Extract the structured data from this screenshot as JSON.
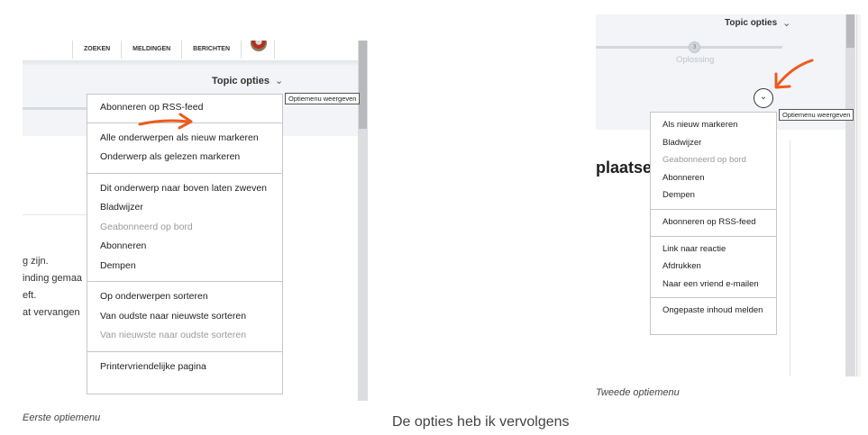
{
  "left_shot": {
    "navbar": [
      "ZOEKEN",
      "MELDINGEN",
      "BERICHTEN"
    ],
    "topic_options_label": "Topic opties",
    "tooltip": "Optiemenu weergeven",
    "menu_sections": [
      [
        {
          "label": "Abonneren op RSS-feed",
          "disabled": false
        }
      ],
      [
        {
          "label": "Alle onderwerpen als nieuw markeren",
          "disabled": false
        },
        {
          "label": "Onderwerp als gelezen markeren",
          "disabled": false
        }
      ],
      [
        {
          "label": "Dit onderwerp naar boven laten zweven",
          "disabled": false
        },
        {
          "label": "Bladwijzer",
          "disabled": false
        },
        {
          "label": "Geabonneerd op bord",
          "disabled": true
        },
        {
          "label": "Abonneren",
          "disabled": false
        },
        {
          "label": "Dempen",
          "disabled": false
        }
      ],
      [
        {
          "label": "Op onderwerpen sorteren",
          "disabled": false
        },
        {
          "label": "Van oudste naar nieuwste sorteren",
          "disabled": false
        },
        {
          "label": "Van nieuwste naar oudste sorteren",
          "disabled": true
        }
      ],
      [
        {
          "label": "Printervriendelijke pagina",
          "disabled": false
        }
      ]
    ],
    "background_lines": [
      "g zijn.",
      "inding gemaa",
      "eft.",
      "at vervangen"
    ],
    "caption": "Eerste optiemenu"
  },
  "right_shot": {
    "topic_options_label": "Topic opties",
    "step_number": "3",
    "step_label": "Oplossing",
    "tooltip": "Optiemenu weergeven",
    "heading_fragment": "plaatsen",
    "menu_sections": [
      [
        {
          "label": "Als nieuw markeren",
          "disabled": false
        },
        {
          "label": "Bladwijzer",
          "disabled": false
        },
        {
          "label": "Geabonneerd op bord",
          "disabled": true
        },
        {
          "label": "Abonneren",
          "disabled": false
        },
        {
          "label": "Dempen",
          "disabled": false
        }
      ],
      [
        {
          "label": "Abonneren op RSS-feed",
          "disabled": false
        }
      ],
      [
        {
          "label": "Link naar reactie",
          "disabled": false
        },
        {
          "label": "Afdrukken",
          "disabled": false
        },
        {
          "label": "Naar een vriend e-mailen",
          "disabled": false
        }
      ],
      [
        {
          "label": "Ongepaste inhoud melden",
          "disabled": false
        }
      ]
    ],
    "caption": "Tweede optiemenu"
  },
  "body_text": "De opties heb ik vervolgens",
  "colors": {
    "arrow": "#ee5a1f",
    "menu_border": "#c6c6c6",
    "disabled_text": "#9a9a9a"
  },
  "icons": [
    "chevron-down-icon",
    "arrow-annotation-icon",
    "logo-emblem-icon"
  ]
}
